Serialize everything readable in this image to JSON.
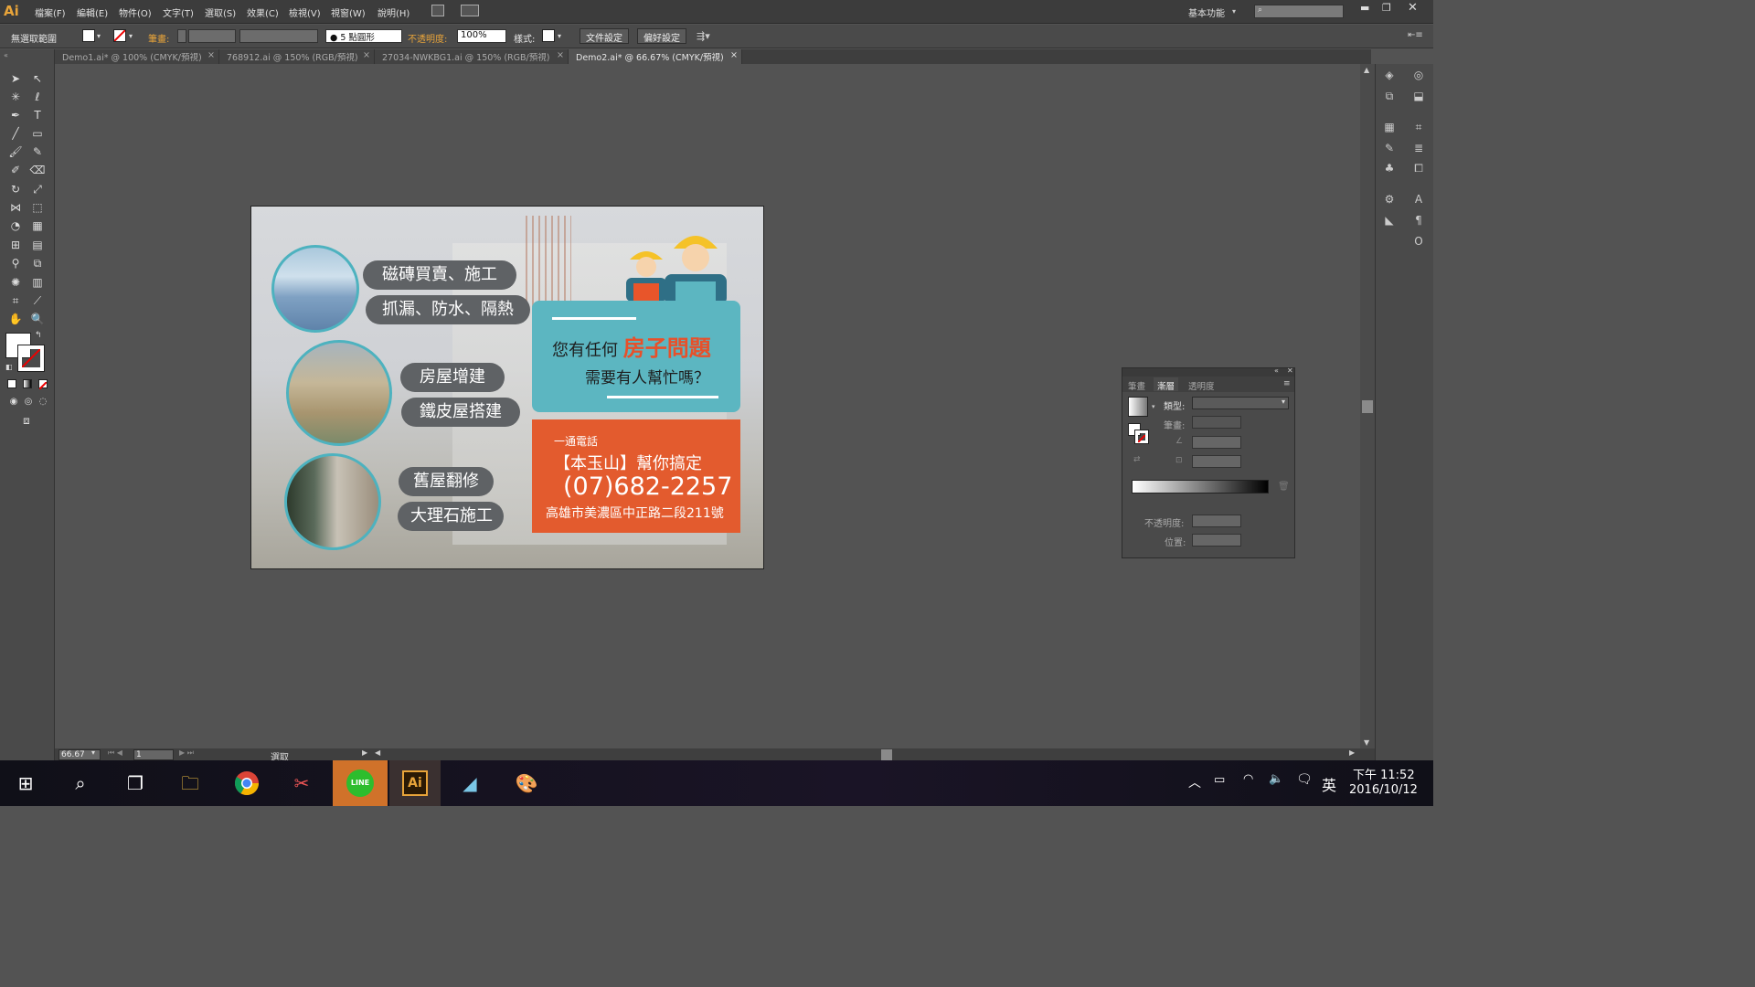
{
  "menubar": {
    "logo": "Ai",
    "items": [
      "檔案(F)",
      "編輯(E)",
      "物件(O)",
      "文字(T)",
      "選取(S)",
      "效果(C)",
      "檢視(V)",
      "視窗(W)",
      "說明(H)"
    ],
    "workspace": "基本功能",
    "search_placeholder": ""
  },
  "control_bar": {
    "selection_label": "無選取範圍",
    "stroke_label": "筆畫:",
    "brush_label": "5 點圓形",
    "opacity_label": "不透明度:",
    "opacity_value": "100%",
    "style_label": "樣式:",
    "doc_setup": "文件設定",
    "prefs": "偏好設定"
  },
  "tabs": [
    {
      "label": "Demo1.ai* @ 100% (CMYK/預視)",
      "active": false
    },
    {
      "label": "768912.ai @ 150% (RGB/預視)",
      "active": false
    },
    {
      "label": "27034-NWKBG1.ai @ 150% (RGB/預視)",
      "active": false
    },
    {
      "label": "Demo2.ai* @ 66.67% (CMYK/預視)",
      "active": true
    }
  ],
  "tab_close": "×",
  "status": {
    "zoom": "66.67",
    "page": "1",
    "mode": "選取"
  },
  "artboard": {
    "pills": [
      "磁磚買賣、施工",
      "抓漏、防水、隔熱",
      "房屋增建",
      "鐵皮屋搭建",
      "舊屋翻修",
      "大理石施工"
    ],
    "question_line1_prefix": "您有任何",
    "question_highlight": "房子問題",
    "question_line2": "需要有人幫忙嗎？",
    "call_label": "一通電話",
    "brand": "【本玉山】幫你搞定",
    "phone": "(07)682-2257",
    "address": "高雄市美濃區中正路二段211號"
  },
  "gradient_panel": {
    "tabs": [
      "筆畫",
      "漸層",
      "透明度"
    ],
    "type_label": "類型:",
    "stroke_label": "筆畫:",
    "opacity_label": "不透明度:",
    "position_label": "位置:"
  },
  "taskbar": {
    "time": "下午 11:52",
    "date": "2016/10/12",
    "ime": "英",
    "ai_label": "Ai",
    "line_label": "LINE"
  },
  "colors": {
    "teal": "#5cb6c1",
    "orange": "#e35b2e",
    "highlight": "#e8502a",
    "ai_orange": "#e8a43a"
  }
}
